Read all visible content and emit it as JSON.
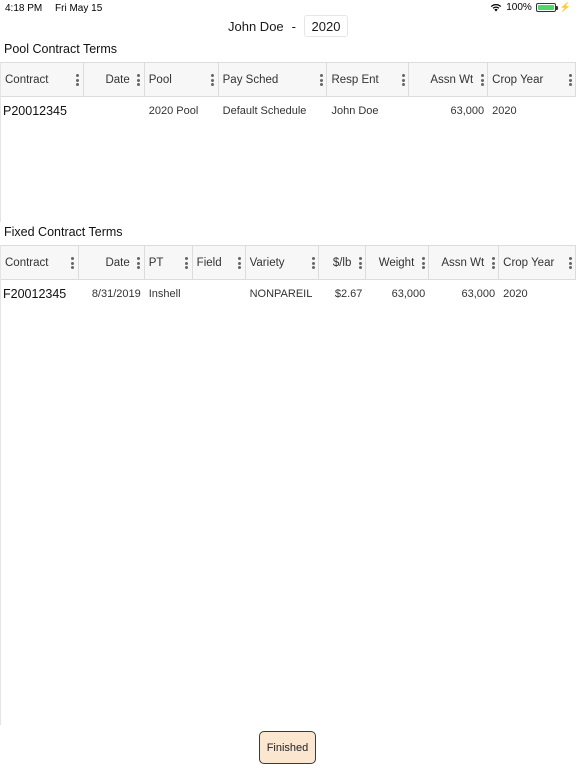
{
  "status_bar": {
    "time": "4:18 PM",
    "date": "Fri May 15",
    "battery": "100%",
    "battery_level": 1.0,
    "icons": [
      "wifi-icon",
      "battery-icon",
      "charging-icon"
    ]
  },
  "header": {
    "name": "John Doe",
    "separator": "-",
    "year": "2020"
  },
  "pool": {
    "title": "Pool Contract Terms",
    "columns": [
      "Contract",
      "Date",
      "Pool",
      "Pay Sched",
      "Resp Ent",
      "Assn Wt",
      "Crop Year"
    ],
    "rows": [
      [
        "P20012345",
        "",
        "2020 Pool",
        "Default Schedule",
        "John Doe",
        "63,000",
        "2020"
      ]
    ]
  },
  "fixed": {
    "title": "Fixed Contract Terms",
    "columns": [
      "Contract",
      "Date",
      "PT",
      "Field",
      "Variety",
      "$/lb",
      "Weight",
      "Assn Wt",
      "Crop Year"
    ],
    "rows": [
      [
        "F20012345",
        "8/31/2019",
        "Inshell",
        "",
        "NONPAREIL",
        "$2.67",
        "63,000",
        "63,000",
        "2020"
      ]
    ]
  },
  "footer": {
    "finished_label": "Finished"
  },
  "colors": {
    "button_bg": "#fbe6d0",
    "header_bg": "#f7f7f7",
    "battery": "#4cd964"
  }
}
